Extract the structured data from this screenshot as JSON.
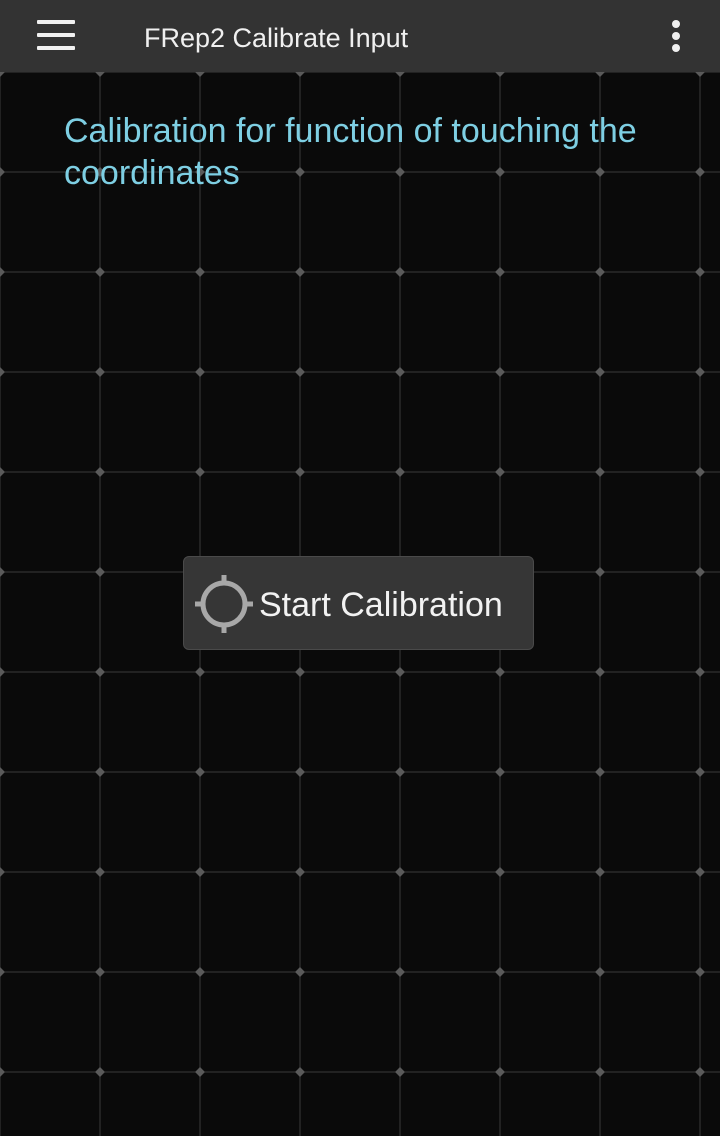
{
  "app_bar": {
    "title": "FRep2 Calibrate Input",
    "menu_icon": "hamburger-menu-icon",
    "overflow_icon": "more-vertical-icon"
  },
  "main": {
    "heading": "Calibration for function of touching the coordinates",
    "start_button": {
      "label": "Start Calibration",
      "icon": "crosshair-icon"
    }
  },
  "colors": {
    "app_bar_bg": "#333333",
    "background": "#0a0a0a",
    "heading_text": "#7ecfe3",
    "grid_line": "#3a3a3a",
    "button_bg": "#363636"
  }
}
